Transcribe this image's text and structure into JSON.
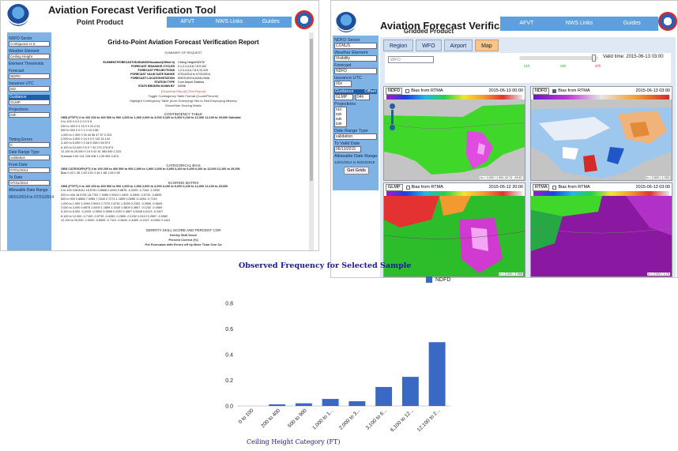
{
  "point": {
    "title": "Aviation Forecast Verification Tool",
    "subtitle": "Point Product",
    "tabs": [
      "AFVT",
      "NWS Links",
      "Guides"
    ],
    "sidebar": [
      {
        "label": "NDFD Sector",
        "value": "Contiguous U.S."
      },
      {
        "label": "Weather Element",
        "value": "Ceiling Height"
      },
      {
        "label": "Element Thresholds",
        "value": ""
      },
      {
        "label": "Forecast",
        "value": "NDFD"
      },
      {
        "label": "Issuance UTC",
        "value": "00z"
      },
      {
        "label": "Guidance",
        "value": "GLMP"
      },
      {
        "label": "Projections",
        "value": "03h"
      },
      {
        "label": "Timing Errors",
        "value": "0"
      },
      {
        "label": "Date Range Type",
        "value": "validation"
      },
      {
        "label": "From Date",
        "value": "07/01/2014"
      },
      {
        "label": "To Date",
        "value": "07/31/2014"
      },
      {
        "label": "Allowable Date Range",
        "value": "06/01/2014 to 07/31/2014"
      }
    ],
    "report_title": "Grid-to-Point Aviation Forecast Verification Report",
    "summary_title": "SUMMARY OF REQUEST",
    "summary": [
      {
        "k": "ELEMENT/FORECAST/GUIDANCE/Issuance(Offset h)",
        "v": "Ceiling Height/NDFD/"
      },
      {
        "k": "FORECAST ISSUANCE CYCLES",
        "v": "0,1,2,3,4,5,6,7,8,9,10Z"
      },
      {
        "k": "FORECAST PROJECTIONS",
        "v": "1,2,3,4,5,6,7,8,9,10,11H"
      },
      {
        "k": "FORECAST VALID DATE RANGE",
        "v": "07/01/2014 to 07/31/2014"
      },
      {
        "k": "FORECAST LOCATION/STATION",
        "v": "KBOS,KDCA,KIAD,KMIA"
      },
      {
        "k": "STATION TYPE",
        "v": "Core Airport Stations"
      },
      {
        "k": "STATS BROKEN DOWN BY",
        "v": "NONE"
      }
    ],
    "graphical_report": "[Graphical Report]",
    "text_report": "[Text Report]",
    "toggle_note": "Toggle Contingency Table Format (Count/Percent)",
    "highlight_note": "Highlight Contingency Table (from Green(ing) Hits to Red Employing Misses)",
    "scoring_note": "Show/Hide Scoring Matrix",
    "contingency_title": "CONTINGENCY TABLE",
    "contingency_rows": [
      "OBS (FT/FT)   0 to 100  200 to 400  500 to 900  1,000 to 1,900  2,000 to 3,000  3,100 to 6,000  6,100 to 12,000  12,100 to 25,000  Subtotal",
      "0 to 100        0         0          0          0          0          0          0          6",
      "200 to 400      0         3          15         0          0          24         0          51",
      "500 to 900      0         0          0          1          0          10         0          88",
      "1,000 to 1,900  0         34         40         56         47         57         0          224",
      "2,000 to 3,000  0         14         0          0          0          115        15         144",
      "3,100 to 6,000  0         3          28         0          258        0          84         574",
      "6,100 to 12,000 0         5          9          7          42         270        276        874",
      "12,100 to 25,000 0        15         0          42         51         583        545        1,323",
      "Subtotal        0         69         131        128        408        1,139      954        3,874"
    ],
    "categorical_title": "CATEGORICAL BIAS",
    "categorical_rows": [
      "OBS CATEGORY(FT)  0 to 100  200 to 400  500 to 900  1,000 to 1,900  2,000 to 3,000  3,100 to 6,000  6,100 to 12,000  12,100 to 25,000",
      "Bias          0.00      1.35      1.63      0.51      2.46      1.68      1.08      0.50"
    ],
    "scoring_title": "SCORING MATRIX",
    "scoring_rows": [
      "OBS (FT/FT)   0 to 100  200 to 400  500 to 900  1,000 to 1,900  2,000 to 3,000  3,100 to 6,000  6,100 to 12,000  12,100 to 25,000",
      "0 to 100      108.8141  18.5781  0.8868  2.4594  0.8878  -0.2025  -0.7163  -1.0000",
      "200 to 400    18.5781   18.7781  7.0089  2.5924  1.0409  -0.0594  -0.5733  -0.8595",
      "500 to 900    0.8868    7.0089   7.1549  2.7274  1.1859  0.0856   -0.4283  -0.7119",
      "1,000 to 1,900 2.4594   2.5924   2.7274  2.8751  1.3335  0.2332   -0.2806  -0.5643",
      "2,000 to 3,000 0.8878   1.0409   1.1859  1.3335  1.4809  0.3807   -0.1232  -0.4069",
      "3,100 to 6,000 -0.2025  -0.0594  0.0856  0.2332  0.3807  0.5548   0.0413  -0.2427",
      "6,100 to 12,000 -0.7163 -0.5733  -0.4283  -0.2806  -0.1232  0.0413  0.2567  -0.0982",
      "12,100 to 25,000 -1.0000 -0.8595 -0.7119  -0.5643  -0.4069  -0.2427  -0.0982  0.1441"
    ],
    "skill_title": "GERRITY SKILL SCORE AND PERCENT COR",
    "skill_rows": [
      "Gerrity Skill Score",
      "Percent Correct (%)",
      "Pct Forecasts with Errors off by More Than One Ca"
    ]
  },
  "gridded": {
    "title": "Aviation Forecast Verification Tool",
    "subtitle": "Gridded Product",
    "tabs": [
      "AFVT",
      "NWS Links",
      "Guides"
    ],
    "sidebar": {
      "ndfd_sector_label": "NDFD Sector",
      "ndfd_sector": "CONUS",
      "weather_element_label": "Weather Element",
      "weather_element": "Visibility",
      "forecast_label": "Forecast",
      "forecast": "NDFD",
      "issuance_label": "Issuance UTC",
      "issuance": "00z",
      "guidance_label": "Guidance",
      "offset_label": "Offset",
      "guidance": "GLMP",
      "offset": "04h",
      "projections_label": "Projections",
      "projections": [
        "01h",
        "02h",
        "03h",
        "04h"
      ],
      "date_range_label": "Date Range Type",
      "date_range": "validation",
      "to_valid_label": "To Valid Date",
      "to_valid": "06/13/2015",
      "allowable_label": "Allowable Date Range",
      "allowable": "12/01/2014 to 06/23/2015",
      "get_grids": "Get Grids"
    },
    "main_tabs": [
      "Region",
      "WFO",
      "Airport",
      "Map"
    ],
    "wfo_placeholder": "WFO",
    "slider_ticks": [
      "01h",
      "25h",
      "37h"
    ],
    "valid_time": "Valid time: 2015-06-13 03:00",
    "panels": [
      {
        "model": "NDFD",
        "bias_label": "Bias from RTMA",
        "bias_checked": false,
        "time": "2015-06-13 00:00",
        "coord": "lo = 1.000 / 1.961\n42.74, -69.87"
      },
      {
        "model": "NDFD",
        "bias_label": "Bias from RTMA",
        "bias_checked": true,
        "time": "2015-06-13 03:00",
        "coord": "lo = 2.600 / 1.000"
      },
      {
        "model": "GLMP",
        "bias_label": "Bias from RTMA",
        "bias_checked": false,
        "time": "2015-06-12 20:00",
        "coord": "lo = 2.000 / 1.568"
      },
      {
        "model": "RTMA",
        "bias_label": "Bias from RTMA",
        "bias_checked": false,
        "time": "2015-06-13 03:00",
        "coord": "lo = 2.000 / 1.76"
      }
    ]
  },
  "colors": {
    "accent": "#5da0dd",
    "sidebar": "#7fb2e5",
    "bar": "#3a68c5",
    "title_blue": "#1a1a99",
    "active_tab": "#f7c58e"
  },
  "chart_data": {
    "type": "bar",
    "title": "Observed Frequency for Selected Sample",
    "xlabel": "Ceiling Height Category (FT)",
    "ylabel": "",
    "categories": [
      "0 to 100",
      "200 to 400",
      "500 to 900",
      "1,000 to 1...",
      "2,000 to 3...",
      "3,100 to 6...",
      "6,100 to 12...",
      "12,100 to 2..."
    ],
    "series": [
      {
        "name": "NDFD",
        "values": [
          0.0,
          0.013,
          0.021,
          0.055,
          0.037,
          0.148,
          0.227,
          0.497
        ]
      }
    ],
    "ylim": [
      0,
      0.8
    ],
    "yticks": [
      "0.0",
      "0.2",
      "0.4",
      "0.6",
      "0.8"
    ],
    "grid": false,
    "legend": "top-right"
  }
}
